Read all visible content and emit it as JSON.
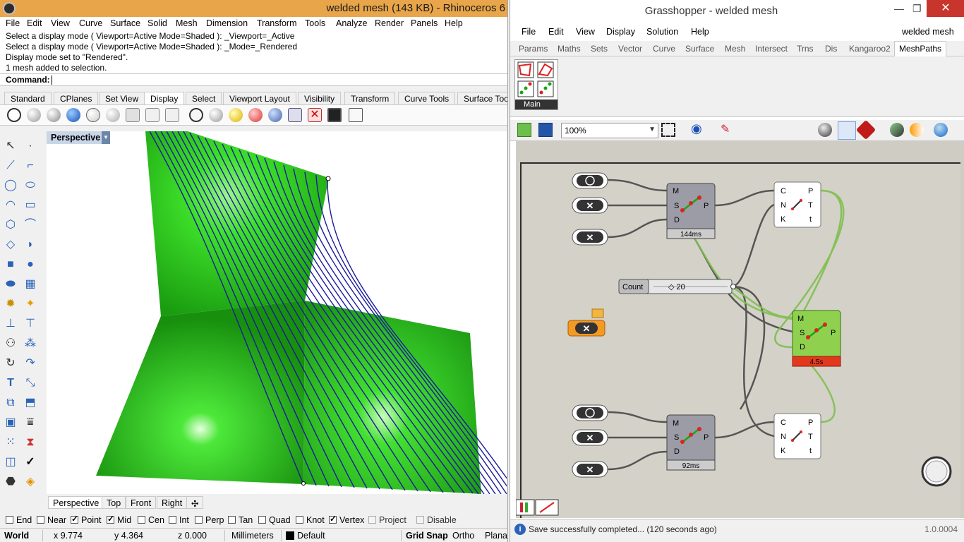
{
  "rhino": {
    "title": "welded mesh (143 KB) - Rhinoceros 6",
    "menu": [
      "File",
      "Edit",
      "View",
      "Curve",
      "Surface",
      "Solid",
      "Mesh",
      "Dimension",
      "Transform",
      "Tools",
      "Analyze",
      "Render",
      "Panels",
      "Help"
    ],
    "history": [
      "Select a display mode ( Viewport=Active  Mode=Shaded ): _Viewport=_Active",
      "Select a display mode ( Viewport=Active  Mode=Shaded ): _Mode=_Rendered",
      "Display mode set to \"Rendered\".",
      "1 mesh added to selection."
    ],
    "command_label": "Command:",
    "toolbar_tabs": [
      "Standard",
      "CPlanes",
      "Set View",
      "Display",
      "Select",
      "Viewport Layout",
      "Visibility",
      "Transform",
      "Curve Tools",
      "Surface Too"
    ],
    "active_tab": "Display",
    "viewport_label": "Perspective",
    "viewport_tabs": [
      "Perspective",
      "Top",
      "Front",
      "Right"
    ],
    "add_tab_glyph": "✣",
    "osnaps": [
      {
        "label": "End",
        "checked": false
      },
      {
        "label": "Near",
        "checked": false
      },
      {
        "label": "Point",
        "checked": true
      },
      {
        "label": "Mid",
        "checked": true
      },
      {
        "label": "Cen",
        "checked": false
      },
      {
        "label": "Int",
        "checked": false
      },
      {
        "label": "Perp",
        "checked": false
      },
      {
        "label": "Tan",
        "checked": false
      },
      {
        "label": "Quad",
        "checked": false
      },
      {
        "label": "Knot",
        "checked": false
      },
      {
        "label": "Vertex",
        "checked": true
      },
      {
        "label": "Project",
        "checked": false,
        "disabled": true
      },
      {
        "label": "Disable",
        "checked": false,
        "disabled": true
      }
    ],
    "status": {
      "cplane": "World",
      "x": "x 9.774",
      "y": "y 4.364",
      "z": "z 0.000",
      "units": "Millimeters",
      "layer": "Default",
      "grid_snap": "Grid Snap",
      "ortho": "Ortho",
      "planar": "Planar"
    },
    "colors": {
      "title_bar": "#e8a54a",
      "mesh": "#2fd41e",
      "curves": "#1a1a9e"
    }
  },
  "gh": {
    "title": "Grasshopper - welded mesh",
    "doc_name": "welded mesh",
    "menu": [
      "File",
      "Edit",
      "View",
      "Display",
      "Solution",
      "Help"
    ],
    "tabs": [
      "Params",
      "Maths",
      "Sets",
      "Vector",
      "Curve",
      "Surface",
      "Mesh",
      "Intersect",
      "Trns",
      "Dis",
      "Kangaroo2",
      "MeshPaths"
    ],
    "active_tab": "MeshPaths",
    "ribbon_group": "Main",
    "zoom": "100%",
    "status_message": "Save successfully completed... (120 seconds ago)",
    "version": "1.0.0004",
    "components": {
      "top_path": {
        "inputs": [
          "M",
          "S",
          "D"
        ],
        "outputs": [
          "P"
        ],
        "time": "144ms"
      },
      "top_curve": {
        "inputs": [
          "C",
          "N",
          "K"
        ],
        "outputs": [
          "P",
          "T",
          "t"
        ]
      },
      "slider": {
        "label": "Count",
        "value": "20"
      },
      "mid_path": {
        "inputs": [
          "M",
          "S",
          "D"
        ],
        "outputs": [
          "P"
        ],
        "time": "4.5s"
      },
      "bot_path": {
        "inputs": [
          "M",
          "S",
          "D"
        ],
        "outputs": [
          "P"
        ],
        "time": "92ms"
      },
      "bot_curve": {
        "inputs": [
          "C",
          "N",
          "K"
        ],
        "outputs": [
          "P",
          "T",
          "t"
        ]
      }
    }
  }
}
